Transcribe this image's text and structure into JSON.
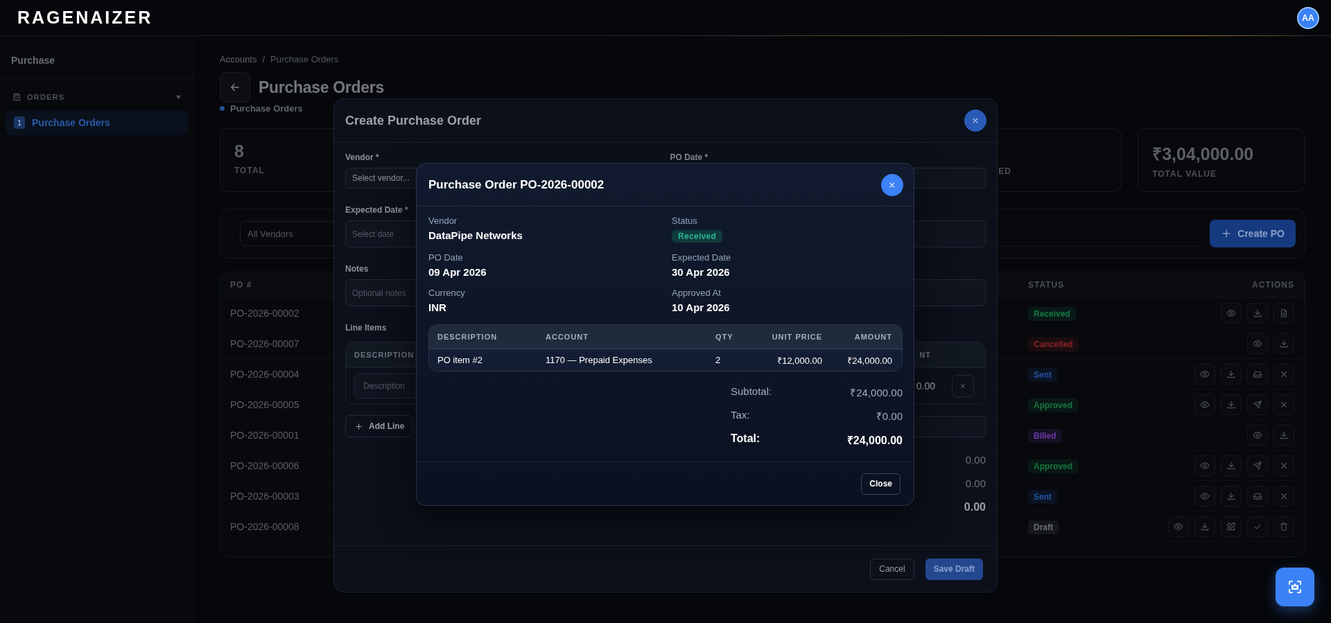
{
  "app": {
    "logo": "RAGENAIZER",
    "avatar": "AA"
  },
  "sidebar": {
    "title": "Purchase",
    "sections": [
      {
        "label": "ORDERS",
        "expanded": true,
        "items": [
          {
            "badge": "1",
            "label": "Purchase Orders",
            "selected": true
          }
        ]
      }
    ]
  },
  "page": {
    "breadcrumb": {
      "items": [
        "Accounts",
        "Purchase Orders"
      ],
      "separator": "/"
    },
    "title": "Purchase Orders",
    "subtitle": "Purchase Orders"
  },
  "stats": [
    {
      "value": "8",
      "label": "TOTAL"
    },
    {
      "label": "ED"
    },
    {
      "value": "₹3,04,000.00",
      "label": "TOTAL VALUE"
    }
  ],
  "filters": {
    "vendor": "All Vendors",
    "create_button": "Create PO"
  },
  "table": {
    "columns": [
      "PO #",
      "STATUS",
      "ACTIONS"
    ],
    "rows": [
      {
        "po": "PO-2026-00002",
        "status": "Received",
        "color": "#147a48",
        "actions": [
          {
            "kind": "view"
          },
          {
            "kind": "download"
          },
          {
            "kind": "document"
          }
        ]
      },
      {
        "po": "PO-2026-00007",
        "status": "Cancelled",
        "color": "#8a2424",
        "actions": [
          {
            "kind": "view"
          },
          {
            "kind": "download"
          }
        ]
      },
      {
        "po": "PO-2026-00004",
        "status": "Sent",
        "color": "#2453a3",
        "actions": [
          {
            "kind": "view"
          },
          {
            "kind": "download"
          },
          {
            "kind": "receive"
          },
          {
            "kind": "cancel"
          }
        ]
      },
      {
        "po": "PO-2026-00005",
        "status": "Approved",
        "color": "#17753f",
        "actions": [
          {
            "kind": "view"
          },
          {
            "kind": "download"
          },
          {
            "kind": "send"
          },
          {
            "kind": "cancel"
          }
        ]
      },
      {
        "po": "PO-2026-00001",
        "status": "Billed",
        "color": "#6a3aa8",
        "actions": [
          {
            "kind": "view"
          },
          {
            "kind": "download"
          }
        ]
      },
      {
        "po": "PO-2026-00006",
        "status": "Approved",
        "color": "#17753f",
        "actions": [
          {
            "kind": "view"
          },
          {
            "kind": "download"
          },
          {
            "kind": "send"
          },
          {
            "kind": "cancel"
          }
        ]
      },
      {
        "po": "PO-2026-00003",
        "status": "Sent",
        "color": "#2453a3",
        "actions": [
          {
            "kind": "view"
          },
          {
            "kind": "download"
          },
          {
            "kind": "receive"
          },
          {
            "kind": "cancel"
          }
        ]
      },
      {
        "po": "PO-2026-00008",
        "status": "Draft",
        "color": "#6a6e76",
        "actions": [
          {
            "kind": "view"
          },
          {
            "kind": "download"
          },
          {
            "kind": "edit"
          },
          {
            "kind": "approve"
          },
          {
            "kind": "delete"
          }
        ]
      }
    ]
  },
  "create_dialog": {
    "title": "Create Purchase Order",
    "vendor": {
      "label": "Vendor *",
      "placeholder": "Select vendor..."
    },
    "po_date": {
      "label": "PO Date *"
    },
    "expected_date": {
      "label": "Expected Date *",
      "placeholder": "Select date"
    },
    "notes": {
      "label": "Notes",
      "placeholder": "Optional notes"
    },
    "line_items": {
      "label": "Line Items",
      "columns": [
        "DESCRIPTION",
        "NT"
      ],
      "rows": [
        {
          "placeholder": "Description",
          "amount": "0.00"
        }
      ],
      "add_button": "Add Line"
    },
    "totals": [
      {
        "value": "0.00",
        "kind": "normal"
      },
      {
        "value": "0.00",
        "kind": "normal"
      },
      {
        "value": "0.00",
        "kind": "total"
      }
    ],
    "cancel_button": "Cancel",
    "save_button": "Save Draft"
  },
  "detail_dialog": {
    "title": "Purchase Order PO-2026-00002",
    "fields": [
      {
        "label": "Vendor",
        "value": "DataPipe Networks",
        "kind": "text"
      },
      {
        "label": "Status",
        "value": "Received",
        "kind": "badge"
      },
      {
        "label": "PO Date",
        "value": "09 Apr 2026",
        "kind": "text"
      },
      {
        "label": "Expected Date",
        "value": "30 Apr 2026",
        "kind": "text"
      },
      {
        "label": "Currency",
        "value": "INR",
        "kind": "text"
      },
      {
        "label": "Approved At",
        "value": "10 Apr 2026",
        "kind": "text"
      }
    ],
    "table": {
      "columns": [
        "DESCRIPTION",
        "ACCOUNT",
        "QTY",
        "UNIT PRICE",
        "AMOUNT"
      ],
      "rows": [
        [
          "PO item #2",
          "1170 — Prepaid Expenses",
          "2",
          "₹12,000.00",
          "₹24,000.00"
        ]
      ]
    },
    "totals": [
      {
        "label": "Subtotal:",
        "value": "₹24,000.00",
        "kind": "normal"
      },
      {
        "label": "Tax:",
        "value": "₹0.00",
        "kind": "normal"
      },
      {
        "label": "Total:",
        "value": "₹24,000.00",
        "kind": "total"
      }
    ],
    "close_button": "Close"
  }
}
